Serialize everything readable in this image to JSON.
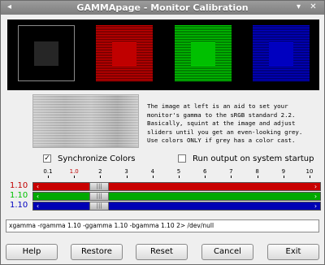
{
  "window": {
    "title": "GAMMApage - Monitor Calibration",
    "menu_glyph": "◂",
    "min_glyph": "▾",
    "close_glyph": "✕"
  },
  "description": "The image at left is an aid to set your\nmonitor's gamma to the sRGB standard 2.2.\nBasically, squint at the image and adjust\nsliders until you get an even-looking grey.\nUse colors ONLY if grey has a color cast.",
  "options": {
    "sync_colors": {
      "label": "Synchronize Colors",
      "checked": true,
      "mark": "✓"
    },
    "run_on_startup": {
      "label": "Run output on system startup",
      "checked": false,
      "mark": ""
    }
  },
  "scale": {
    "ticks": [
      "0.1",
      "1.0",
      "2",
      "3",
      "4",
      "5",
      "6",
      "7",
      "8",
      "9",
      "10"
    ],
    "highlight_tick": "1.0"
  },
  "channels": [
    {
      "name": "red",
      "value_label": "1.10",
      "value": 1.1,
      "color": "#c00000",
      "track": "#c80000"
    },
    {
      "name": "green",
      "value_label": "1.10",
      "value": 1.1,
      "color": "#00c000",
      "track": "#00a800"
    },
    {
      "name": "blue",
      "value_label": "1.10",
      "value": 1.1,
      "color": "#0000c0",
      "track": "#0000b4"
    }
  ],
  "slider_range": [
    0.1,
    10
  ],
  "command": "xgamma -rgamma 1.10 -ggamma 1.10 -bgamma 1.10 2> /dev/null",
  "buttons": {
    "help": "Help",
    "restore": "Restore",
    "reset": "Reset",
    "cancel": "Cancel",
    "exit": "Exit"
  },
  "arrows": {
    "left": "‹",
    "right": "›",
    "grip": "|||"
  }
}
